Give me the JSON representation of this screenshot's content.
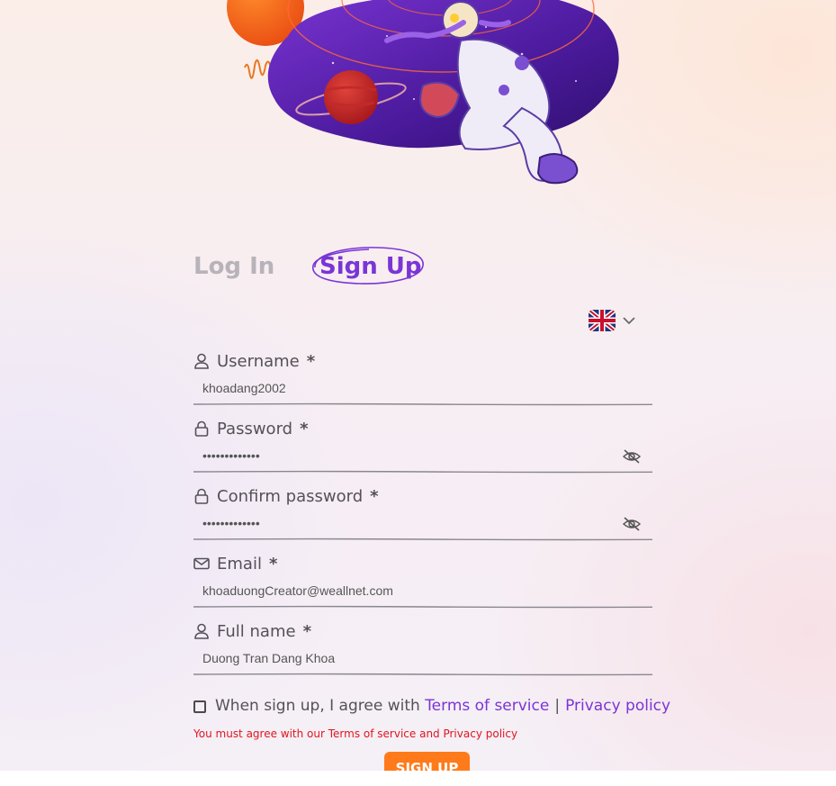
{
  "tabs": {
    "login": "Log In",
    "signup": "Sign Up",
    "active": "signup"
  },
  "language": {
    "selected": "English (UK)",
    "flag_icon": "uk-flag-icon"
  },
  "fields": {
    "username": {
      "label": "Username",
      "required_mark": "*",
      "value": "khoadang2002"
    },
    "password": {
      "label": "Password",
      "required_mark": "*",
      "value": "•••••••••••••"
    },
    "confirm_password": {
      "label": "Confirm password",
      "required_mark": "*",
      "value": "•••••••••••••"
    },
    "email": {
      "label": "Email",
      "required_mark": "*",
      "value": "khoaduongCreator@weallnet.com"
    },
    "full_name": {
      "label": "Full name",
      "required_mark": "*",
      "value": "Duong Tran Dang Khoa"
    }
  },
  "agreement": {
    "text": "When sign up, I agree with",
    "terms_link": "Terms of service",
    "separator": "|",
    "privacy_link": "Privacy policy",
    "checked": false
  },
  "error_message": "You must agree with our Terms of service and Privacy policy",
  "submit_label": "SIGN UP",
  "colors": {
    "accent": "#7a35d6",
    "button": "#ff7a1a",
    "error": "#e0161f",
    "inactive_tab": "#b7b3b8"
  }
}
